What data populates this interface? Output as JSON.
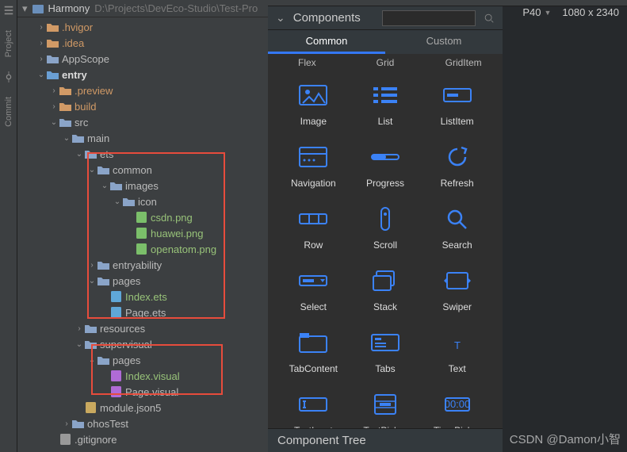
{
  "rail": {
    "project": "Project",
    "commit": "Commit"
  },
  "project": {
    "name": "Harmony",
    "path": "D:\\Projects\\DevEco-Studio\\Test-Pro"
  },
  "tree": [
    {
      "d": 1,
      "a": ">",
      "t": "folder-o",
      "l": ".hvigor"
    },
    {
      "d": 1,
      "a": ">",
      "t": "folder-o",
      "l": ".idea"
    },
    {
      "d": 1,
      "a": ">",
      "t": "folder",
      "l": "AppScope"
    },
    {
      "d": 1,
      "a": "v",
      "t": "folder-b",
      "l": "entry",
      "cls": "entry"
    },
    {
      "d": 2,
      "a": ">",
      "t": "folder-o",
      "l": ".preview"
    },
    {
      "d": 2,
      "a": ">",
      "t": "folder-o",
      "l": "build"
    },
    {
      "d": 2,
      "a": "v",
      "t": "folder",
      "l": "src"
    },
    {
      "d": 3,
      "a": "v",
      "t": "folder",
      "l": "main"
    },
    {
      "d": 4,
      "a": "v",
      "t": "folder",
      "l": "ets"
    },
    {
      "d": 5,
      "a": "v",
      "t": "folder",
      "l": "common"
    },
    {
      "d": 6,
      "a": "v",
      "t": "folder",
      "l": "images"
    },
    {
      "d": 7,
      "a": "v",
      "t": "folder",
      "l": "icon"
    },
    {
      "d": 8,
      "a": "",
      "t": "img",
      "l": "csdn.png",
      "cls": "green"
    },
    {
      "d": 8,
      "a": "",
      "t": "img",
      "l": "huawei.png",
      "cls": "green"
    },
    {
      "d": 8,
      "a": "",
      "t": "img",
      "l": "openatom.png",
      "cls": "green"
    },
    {
      "d": 5,
      "a": ">",
      "t": "folder",
      "l": "entryability"
    },
    {
      "d": 5,
      "a": "v",
      "t": "folder",
      "l": "pages"
    },
    {
      "d": 6,
      "a": "",
      "t": "ets",
      "l": "Index.ets",
      "cls": "green"
    },
    {
      "d": 6,
      "a": "",
      "t": "ets",
      "l": "Page.ets"
    },
    {
      "d": 4,
      "a": ">",
      "t": "folder",
      "l": "resources"
    },
    {
      "d": 4,
      "a": "v",
      "t": "folder",
      "l": "supervisual"
    },
    {
      "d": 5,
      "a": "v",
      "t": "folder",
      "l": "pages"
    },
    {
      "d": 6,
      "a": "",
      "t": "vis",
      "l": "Index.visual",
      "cls": "green"
    },
    {
      "d": 6,
      "a": "",
      "t": "vis",
      "l": "Page.visual"
    },
    {
      "d": 4,
      "a": "",
      "t": "json",
      "l": "module.json5"
    },
    {
      "d": 3,
      "a": ">",
      "t": "folder",
      "l": "ohosTest"
    },
    {
      "d": 2,
      "a": "",
      "t": "file",
      "l": ".gitignore"
    }
  ],
  "components": {
    "title": "Components",
    "search_placeholder": "",
    "device": "P40",
    "resolution": "1080 x 2340",
    "tabs": {
      "common": "Common",
      "custom": "Custom"
    },
    "sublabels": [
      "Flex",
      "Grid",
      "GridItem"
    ],
    "items": [
      "Image",
      "List",
      "ListItem",
      "Navigation",
      "Progress",
      "Refresh",
      "Row",
      "Scroll",
      "Search",
      "Select",
      "Stack",
      "Swiper",
      "TabContent",
      "Tabs",
      "Text",
      "TextInput",
      "TextPicker",
      "TimePicker"
    ],
    "footer": "Component Tree"
  },
  "watermark": "CSDN @Damon小智"
}
